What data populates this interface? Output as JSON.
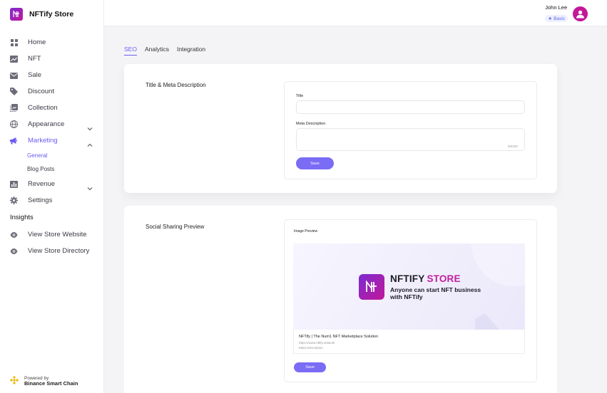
{
  "brand": {
    "name": "NFTify Store"
  },
  "sidebar": {
    "items": [
      {
        "label": "Home",
        "icon": "grid-icon"
      },
      {
        "label": "NFT",
        "icon": "chart-icon"
      },
      {
        "label": "Sale",
        "icon": "mail-icon"
      },
      {
        "label": "Discount",
        "icon": "tag-icon"
      },
      {
        "label": "Collection",
        "icon": "collection-icon"
      },
      {
        "label": "Appearance",
        "icon": "globe-icon"
      },
      {
        "label": "Marketing",
        "icon": "megaphone-icon"
      },
      {
        "label": "Revenue",
        "icon": "bar-chart-icon"
      },
      {
        "label": "Settings",
        "icon": "gear-icon"
      }
    ],
    "marketing_sub": [
      "General",
      "Blog Posts"
    ],
    "insights_title": "Insights",
    "insights": [
      {
        "label": "View Store Website",
        "icon": "eye-icon"
      },
      {
        "label": "View Store Directory",
        "icon": "eye-icon"
      }
    ],
    "powered_by": "Powered by",
    "powered_chain": "Binance Smart Chain"
  },
  "user": {
    "name": "John Lee",
    "plan": "Basic"
  },
  "tabs": [
    "SEO",
    "Analytics",
    "Integration"
  ],
  "seo": {
    "section_title": "Title & Meta Description",
    "title_label": "Title",
    "title_value": "",
    "meta_label": "Meta Description",
    "meta_value": "",
    "counter": "50/320",
    "save_label": "Save"
  },
  "social": {
    "section_title": "Social Sharing Preview",
    "image_label": "Image Preview",
    "preview_brand_1": "NFTIFY",
    "preview_brand_2": "STORE",
    "preview_tagline": "Anyone can start NFT business with NFTify",
    "meta_title": "NFTify | The Num1 NFT Marketplace  Solution",
    "meta_url": "https://www.nftify.network",
    "meta_desc": "Meta Description",
    "save_label": "Save"
  },
  "colors": {
    "accent": "#6b5cf0",
    "brand": "#c2189a",
    "button": "#7a6cf5"
  }
}
